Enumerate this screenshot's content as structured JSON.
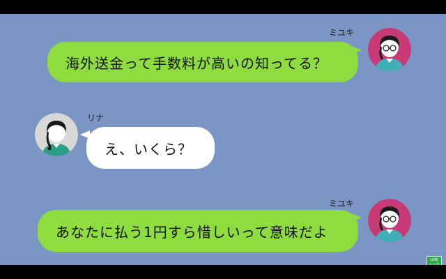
{
  "app": {
    "name": "LINE chat"
  },
  "colors": {
    "chat_background": "#7b95c4",
    "sent_bubble": "#8edc40",
    "received_bubble": "#ffffff",
    "avatar_miyuki": "#c83a76",
    "avatar_rina": "#d8d8d8"
  },
  "messages": [
    {
      "sender": "ミユキ",
      "side": "right",
      "text": "海外送金って手数料が高いの知ってる？"
    },
    {
      "sender": "リナ",
      "side": "left",
      "text": "え、いくら？"
    },
    {
      "sender": "ミユキ",
      "side": "right",
      "text": "あなたに払う1円すら惜しいって意味だよ"
    }
  ],
  "badge": {
    "line1": "LINE",
    "line2": "トーク"
  }
}
